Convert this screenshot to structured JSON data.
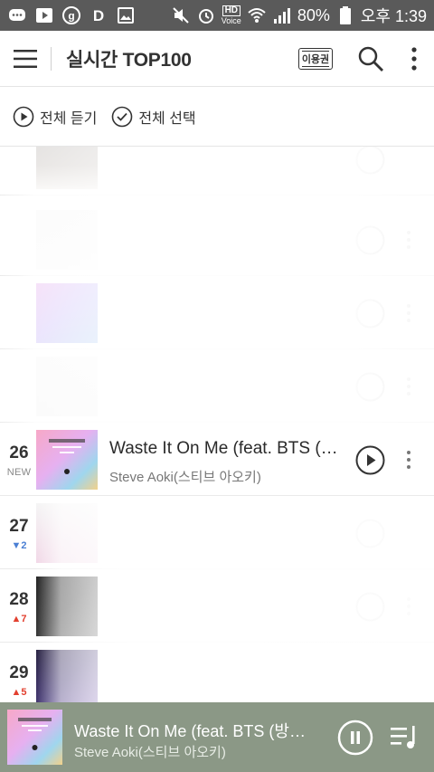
{
  "status_bar": {
    "battery": "80%",
    "time": "오후 1:39",
    "hd_label": "HD",
    "voice_label": "Voice"
  },
  "header": {
    "title": "실시간 TOP100",
    "ticket_label": "이용권"
  },
  "toolbar": {
    "play_all": "전체 듣기",
    "select_all": "전체 선택"
  },
  "list": {
    "rows": [
      {
        "rank": "26",
        "change": "NEW",
        "title": "Waste It On Me (feat. BTS (…",
        "artist": "Steve Aoki(스티브 아오키)"
      },
      {
        "rank": "27",
        "change": "2"
      },
      {
        "rank": "28",
        "change": "7"
      },
      {
        "rank": "29",
        "change": "5"
      }
    ]
  },
  "player": {
    "title": "Waste It On Me (feat. BTS (방…",
    "artist": "Steve Aoki(스티브 아오키)"
  },
  "colors": {
    "accent_up": "#e2402f",
    "accent_down": "#4a7fd4",
    "player_bg": "#8b9886"
  }
}
